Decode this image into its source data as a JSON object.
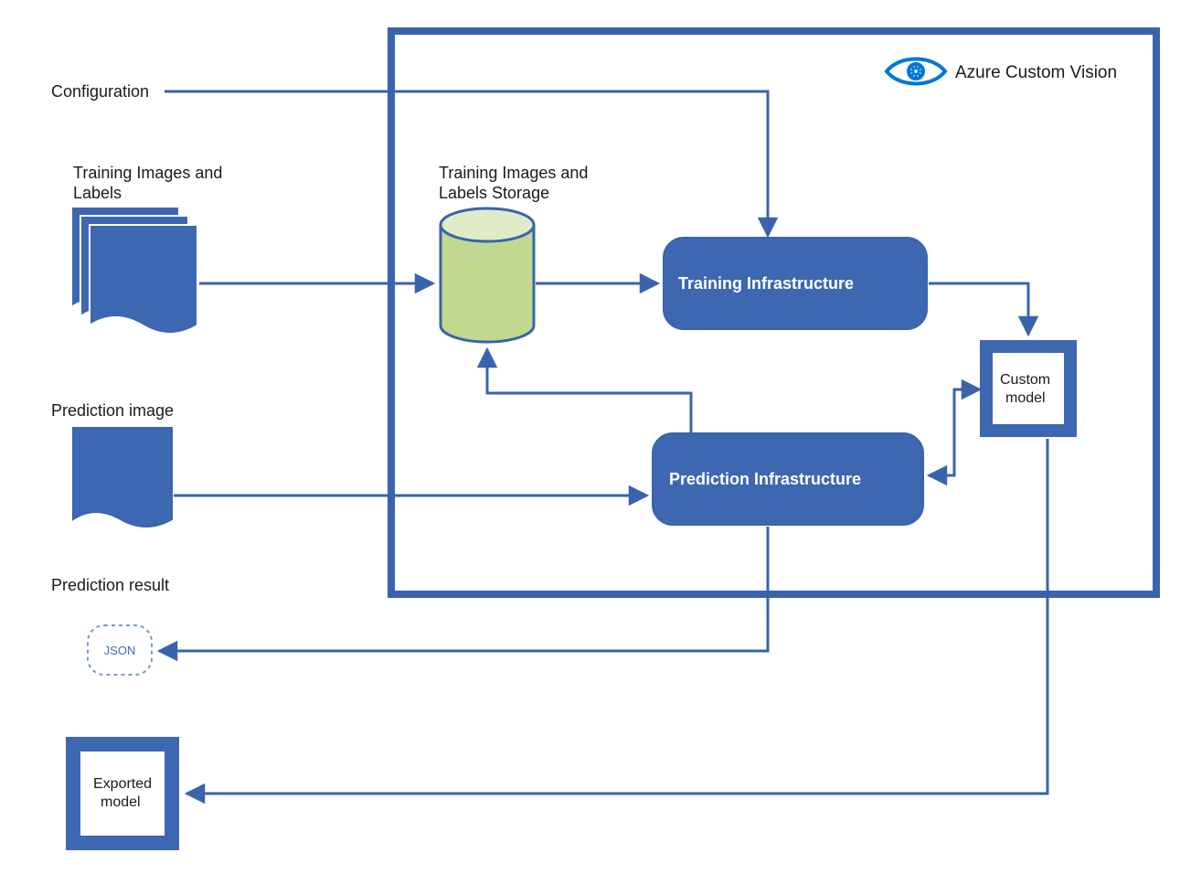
{
  "labels": {
    "configuration": "Configuration",
    "training_images": "Training Images and",
    "training_images_2": "Labels",
    "storage": "Training Images and",
    "storage_2": "Labels Storage",
    "prediction_image": "Prediction image",
    "prediction_result": "Prediction result",
    "json": "JSON",
    "exported_model_1": "Exported",
    "exported_model_2": "model",
    "training_infra": "Training Infrastructure",
    "prediction_infra": "Prediction Infrastructure",
    "custom_model_1": "Custom",
    "custom_model_2": "model",
    "service_name": "Azure Custom Vision"
  },
  "colors": {
    "blue": "#3a63ad",
    "blue_fill": "#3e67b1",
    "green_fill": "#c0d890",
    "green_stroke": "#3a63ad",
    "eye_blue": "#0078d4"
  }
}
